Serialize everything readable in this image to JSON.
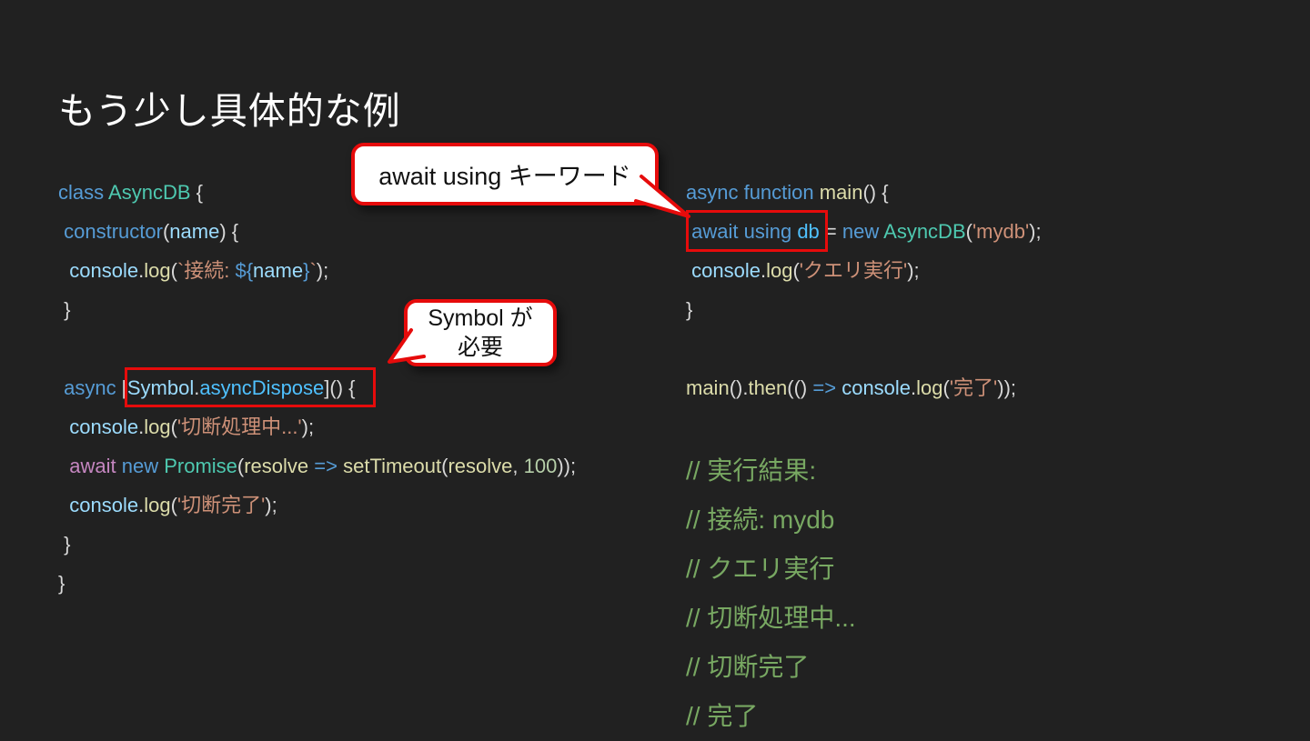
{
  "slide": {
    "background": "#212121",
    "title": "もう少し具体的な例"
  },
  "accent": {
    "red": "#e60b0b",
    "bubble_bg": "#ffffff",
    "bubble_text": "#111111"
  },
  "palette": {
    "keyword": "#569cd6",
    "control": "#c586c0",
    "type": "#4ec9b0",
    "variable": "#9cdcfe",
    "member": "#4fc1ff",
    "function": "#dcdcaa",
    "string": "#ce9178",
    "number": "#b5cea8",
    "comment": "#78a862",
    "plain": "#d8d8d8"
  },
  "code_left": {
    "lines": [
      [
        {
          "t": "class ",
          "c": "keyword"
        },
        {
          "t": "AsyncDB",
          "c": "type"
        },
        {
          "t": " {",
          "c": "plain"
        }
      ],
      [
        {
          "t": " ",
          "c": "plain"
        },
        {
          "t": "constructor",
          "c": "keyword"
        },
        {
          "t": "(",
          "c": "plain"
        },
        {
          "t": "name",
          "c": "variable"
        },
        {
          "t": ") {",
          "c": "plain"
        }
      ],
      [
        {
          "t": "  ",
          "c": "plain"
        },
        {
          "t": "console",
          "c": "variable"
        },
        {
          "t": ".",
          "c": "plain"
        },
        {
          "t": "log",
          "c": "function"
        },
        {
          "t": "(",
          "c": "plain"
        },
        {
          "t": "`接続: ",
          "c": "string"
        },
        {
          "t": "${",
          "c": "keyword"
        },
        {
          "t": "name",
          "c": "variable"
        },
        {
          "t": "}",
          "c": "keyword"
        },
        {
          "t": "`",
          "c": "string"
        },
        {
          "t": ");",
          "c": "plain"
        }
      ],
      [
        {
          "t": " }",
          "c": "plain"
        }
      ],
      [],
      [
        {
          "t": " ",
          "c": "plain"
        },
        {
          "t": "async",
          "c": "keyword"
        },
        {
          "t": " [",
          "c": "plain"
        },
        {
          "t": "Symbol",
          "c": "variable"
        },
        {
          "t": ".",
          "c": "plain"
        },
        {
          "t": "asyncDispose",
          "c": "member"
        },
        {
          "t": "]() {",
          "c": "plain"
        }
      ],
      [
        {
          "t": "  ",
          "c": "plain"
        },
        {
          "t": "console",
          "c": "variable"
        },
        {
          "t": ".",
          "c": "plain"
        },
        {
          "t": "log",
          "c": "function"
        },
        {
          "t": "(",
          "c": "plain"
        },
        {
          "t": "'切断処理中...'",
          "c": "string"
        },
        {
          "t": ");",
          "c": "plain"
        }
      ],
      [
        {
          "t": "  ",
          "c": "plain"
        },
        {
          "t": "await",
          "c": "control"
        },
        {
          "t": " ",
          "c": "plain"
        },
        {
          "t": "new",
          "c": "keyword"
        },
        {
          "t": " ",
          "c": "plain"
        },
        {
          "t": "Promise",
          "c": "type"
        },
        {
          "t": "(",
          "c": "plain"
        },
        {
          "t": "resolve",
          "c": "function"
        },
        {
          "t": " ",
          "c": "plain"
        },
        {
          "t": "=>",
          "c": "keyword"
        },
        {
          "t": " ",
          "c": "plain"
        },
        {
          "t": "setTimeout",
          "c": "function"
        },
        {
          "t": "(",
          "c": "plain"
        },
        {
          "t": "resolve",
          "c": "function"
        },
        {
          "t": ", ",
          "c": "plain"
        },
        {
          "t": "100",
          "c": "number"
        },
        {
          "t": "));",
          "c": "plain"
        }
      ],
      [
        {
          "t": "  ",
          "c": "plain"
        },
        {
          "t": "console",
          "c": "variable"
        },
        {
          "t": ".",
          "c": "plain"
        },
        {
          "t": "log",
          "c": "function"
        },
        {
          "t": "(",
          "c": "plain"
        },
        {
          "t": "'切断完了'",
          "c": "string"
        },
        {
          "t": ");",
          "c": "plain"
        }
      ],
      [
        {
          "t": " }",
          "c": "plain"
        }
      ],
      [
        {
          "t": "}",
          "c": "plain"
        }
      ]
    ]
  },
  "code_right": {
    "lines": [
      [
        {
          "t": "async function ",
          "c": "keyword"
        },
        {
          "t": "main",
          "c": "function"
        },
        {
          "t": "() {",
          "c": "plain"
        }
      ],
      [
        {
          "t": " ",
          "c": "plain"
        },
        {
          "t": "await using ",
          "c": "keyword"
        },
        {
          "t": "db",
          "c": "member"
        },
        {
          "t": " = ",
          "c": "plain"
        },
        {
          "t": "new",
          "c": "keyword"
        },
        {
          "t": " ",
          "c": "plain"
        },
        {
          "t": "AsyncDB",
          "c": "type"
        },
        {
          "t": "(",
          "c": "plain"
        },
        {
          "t": "'mydb'",
          "c": "string"
        },
        {
          "t": ");",
          "c": "plain"
        }
      ],
      [
        {
          "t": " ",
          "c": "plain"
        },
        {
          "t": "console",
          "c": "variable"
        },
        {
          "t": ".",
          "c": "plain"
        },
        {
          "t": "log",
          "c": "function"
        },
        {
          "t": "(",
          "c": "plain"
        },
        {
          "t": "'クエリ実行'",
          "c": "string"
        },
        {
          "t": ");",
          "c": "plain"
        }
      ],
      [
        {
          "t": "}",
          "c": "plain"
        }
      ],
      [],
      [
        {
          "t": "main",
          "c": "function"
        },
        {
          "t": "().",
          "c": "plain"
        },
        {
          "t": "then",
          "c": "function"
        },
        {
          "t": "(() ",
          "c": "plain"
        },
        {
          "t": "=>",
          "c": "keyword"
        },
        {
          "t": " ",
          "c": "plain"
        },
        {
          "t": "console",
          "c": "variable"
        },
        {
          "t": ".",
          "c": "plain"
        },
        {
          "t": "log",
          "c": "function"
        },
        {
          "t": "(",
          "c": "plain"
        },
        {
          "t": "'完了'",
          "c": "string"
        },
        {
          "t": "));",
          "c": "plain"
        }
      ]
    ]
  },
  "output_comments": {
    "lines": [
      "// 実行結果:",
      "// 接続: mydb",
      "// クエリ実行",
      "// 切断処理中...",
      "// 切断完了",
      "// 完了"
    ]
  },
  "callouts": {
    "await_using": {
      "text": "await using キーワード"
    },
    "symbol": {
      "lines": [
        "Symbol が",
        "必要"
      ]
    }
  }
}
